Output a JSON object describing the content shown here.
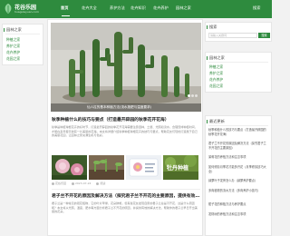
{
  "site": {
    "name": "花谷乐园",
    "subtitle": "huaguleyuan.com"
  },
  "nav": [
    "首页",
    "花卉大全",
    "养护方法",
    "花卉知识",
    "花卉养护",
    "园林之家"
  ],
  "nav_right": "搜索",
  "left_sidebar": {
    "heading": "园林之家",
    "items": [
      "种植之家",
      "养护之家",
      "花卉养护",
      "花园之家"
    ]
  },
  "hero": {
    "caption": "仙人柱的基本种植方法(浇水施肥与温度要求)",
    "slides": 3,
    "active_slide": 1
  },
  "articles": [
    {
      "title": "秋季种植什么的技巧与要点（打造最开辟园的秋季花开花海）",
      "excerpt": "秋季是种植球根花卉的好时节，打造最开辟园的秋季花开花海需要注意选种、土壤、光照和浇水，合理安排种植时间，才能在来年春天收获一片美丽的花海。本文将详细介绍秋季种植球根花卉的技巧与要点，帮助花友们轻松打造属于自己的美丽花园，让园林之家充满生机与色彩。",
      "thumb_text": "牡丹种植",
      "meta": {
        "author": "花谷乐园",
        "date": "2023-07-24",
        "views": "阅读"
      }
    },
    {
      "title": "君子兰不开花的原因及解决方法（探究君子兰不开花的主要原因，提供有效的解决...",
      "excerpt": "君子兰是一种常见的观花植物，它的叶片翠绿，花朵鲜艳，但有些花友发现自家的君子兰总是不开花，这是什么原因呢？本文将从光照、温度、肥水等方面分析君子兰不开花的原因，并提供有效的解决方法，帮助你的君子兰早日开出美丽的花朵。"
    }
  ],
  "right_sidebar": {
    "search_heading": "搜索",
    "search_placeholder": "请输入关键词",
    "search_button": "搜索",
    "links_heading": "园林之家",
    "links": [
      "种植之家",
      "养护之家",
      "花卉养护",
      "花园之家"
    ],
    "recent_heading": "最近更新",
    "recent": [
      "秋季种植什么的技巧与要点（打造最开辟园的秋季花开花海）",
      "君子兰不开花的原因及解决方法（探究君子兰不开花的主要原因）",
      "茉莉花的养殖方法和注意事项",
      "如何修剪月季花才能多开花（月季修剪技巧大全）",
      "绿萝叶子发黄怎么办（绿萝养护要点）",
      "多肉植物的浇水方法（多肉养护小技巧）",
      "栀子花的种植方法与养护要点",
      "发财树的养殖方法和注意事项"
    ]
  }
}
